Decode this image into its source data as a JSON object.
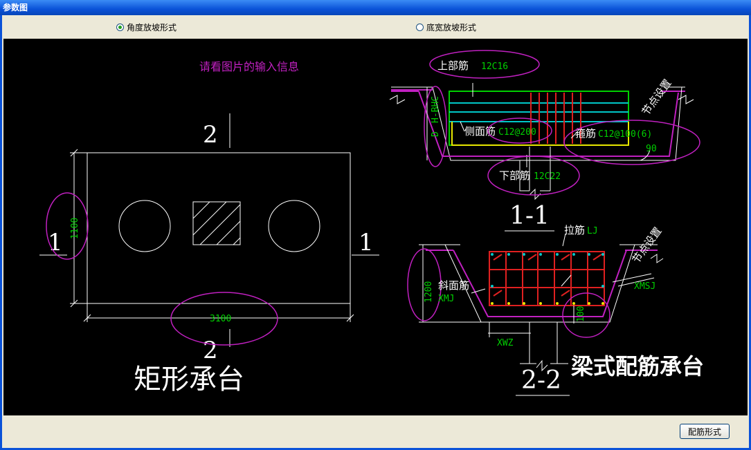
{
  "window": {
    "title": "参数图"
  },
  "options": {
    "angle_slope": "角度放坡形式",
    "width_slope": "底宽放坡形式",
    "selected": "angle_slope"
  },
  "diagram": {
    "hint": "请看图片的输入信息",
    "left": {
      "section_top": "2",
      "section_bottom": "2",
      "section_left": "1",
      "section_right": "1",
      "dim_height": "1100",
      "dim_width": "3100",
      "caption": "矩形承台"
    },
    "section11": {
      "top_bar_label": "上部筋",
      "top_bar_value": "12C16",
      "side_bar_label": "侧面筋",
      "side_bar_value": "C12@200",
      "stirrup_label": "箍筋",
      "stirrup_value": "C12@100(6)",
      "bottom_bar_label": "下部筋",
      "bottom_bar_value": "12C22",
      "h_bhc": "H-BHC",
      "d_label": "D",
      "node_label": "节点设置",
      "angle": "90",
      "title": "1-1"
    },
    "section22": {
      "tie_label": "拉筋",
      "tie_value": "LJ",
      "node_label": "节点设置",
      "dim_height": "1200",
      "slope_label": "斜面筋",
      "xmj": "XMJ",
      "xmsj": "XMSJ",
      "xwz": "XWZ",
      "dim_100": "100",
      "title": "2-2"
    },
    "caption_beam": "梁式配筋承台"
  },
  "footer": {
    "config_button": "配筋形式"
  },
  "colors": {
    "magenta": "#c020c0",
    "green": "#00d000",
    "cyan": "#00c8c8",
    "yellow": "#e8e800",
    "red": "#e02020",
    "white": "#ffffff"
  }
}
